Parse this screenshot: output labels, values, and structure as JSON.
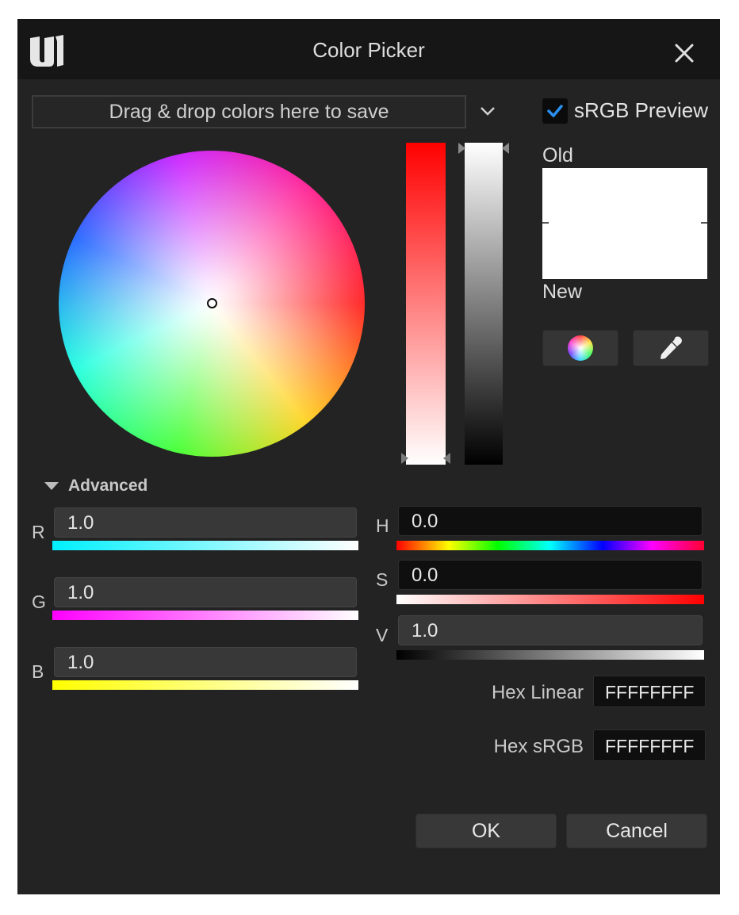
{
  "window": {
    "title": "Color Picker"
  },
  "toolbar": {
    "dropzone_text": "Drag & drop colors here to save",
    "srgb_preview_label": "sRGB Preview",
    "srgb_preview_checked": true
  },
  "preview": {
    "old_label": "Old",
    "new_label": "New",
    "old_color": "#ffffff",
    "new_color": "#ffffff"
  },
  "advanced": {
    "label": "Advanced",
    "expanded": true
  },
  "rgb": [
    {
      "channel": "R",
      "value": "1.0"
    },
    {
      "channel": "G",
      "value": "1.0"
    },
    {
      "channel": "B",
      "value": "1.0"
    }
  ],
  "hsv": [
    {
      "channel": "H",
      "value": "0.0"
    },
    {
      "channel": "S",
      "value": "0.0"
    },
    {
      "channel": "V",
      "value": "1.0"
    }
  ],
  "hex": {
    "linear_label": "Hex Linear",
    "linear_value": "FFFFFFFF",
    "srgb_label": "Hex sRGB",
    "srgb_value": "FFFFFFFF"
  },
  "buttons": {
    "ok": "OK",
    "cancel": "Cancel"
  },
  "colors": {
    "window_bg": "#232323",
    "titlebar_bg": "#161616",
    "accent_check": "#2b8ff0"
  },
  "icons": [
    "unreal-logo-icon",
    "close-icon",
    "chevron-down-icon",
    "checkmark-icon",
    "color-wheel-icon",
    "eyedropper-icon"
  ]
}
